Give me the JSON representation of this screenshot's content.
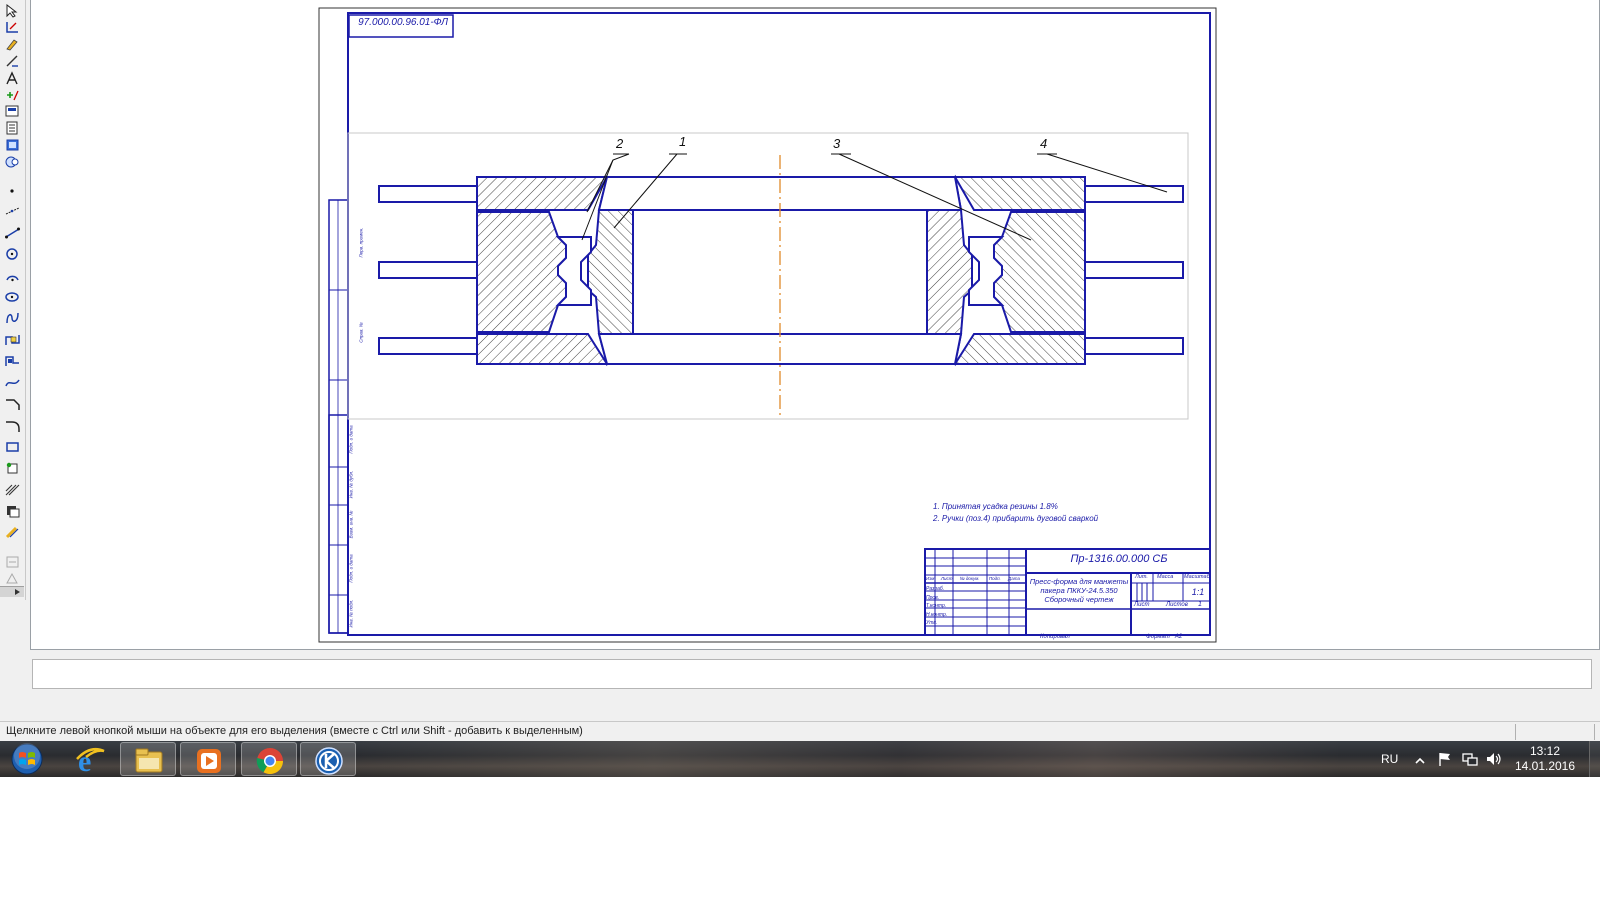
{
  "drawing": {
    "stamp_top_left": "97.000.00.96.01-ФЛ",
    "callouts": [
      "2",
      "1",
      "3",
      "4"
    ],
    "notes": [
      "1. Принятая усадка резины 1.8%",
      "2. Ручки (поз.4) прибарить дуговой сваркой"
    ],
    "title_block": {
      "designation": "Пр-1316.00.000 СБ",
      "name_line1": "Пресс-форма для манжеты",
      "name_line2": "пакера ПККУ-24.5.350",
      "name_line3": "Сборочный чертеж",
      "col_lit": "Лит.",
      "col_mass": "Масса",
      "col_scale": "Масштаб",
      "scale_value": "1:1",
      "sheet_label": "Лист",
      "sheets_label": "Листов",
      "sheets_value": "1",
      "row_labels": [
        "Изм.",
        "Лист",
        "№ докум.",
        "Подп.",
        "Дата"
      ],
      "sign_labels": [
        "Разраб.",
        "Пров.",
        "Т.контр.",
        "",
        "Н.контр.",
        "Утв."
      ],
      "copied": "Копировал",
      "format": "Формат   А2"
    },
    "left_strip_labels": [
      "Перв. примен.",
      "Справ. №",
      "Подп. и дата",
      "Инв. № дубл.",
      "Взам. инв. №",
      "Подп. и дата",
      "Инв. № подл."
    ]
  },
  "status": {
    "message": "Щелкните левой кнопкой мыши на объекте для его выделения (вместе с Ctrl или Shift - добавить к выделенным)"
  },
  "taskbar": {
    "lang": "RU",
    "time": "13:12",
    "date": "14.01.2016"
  },
  "icons": {
    "start": "windows-start-icon",
    "ie": "internet-explorer-icon",
    "explorer": "file-explorer-icon",
    "media": "media-player-icon",
    "chrome": "chrome-icon",
    "kompas": "kompas-3d-icon"
  }
}
